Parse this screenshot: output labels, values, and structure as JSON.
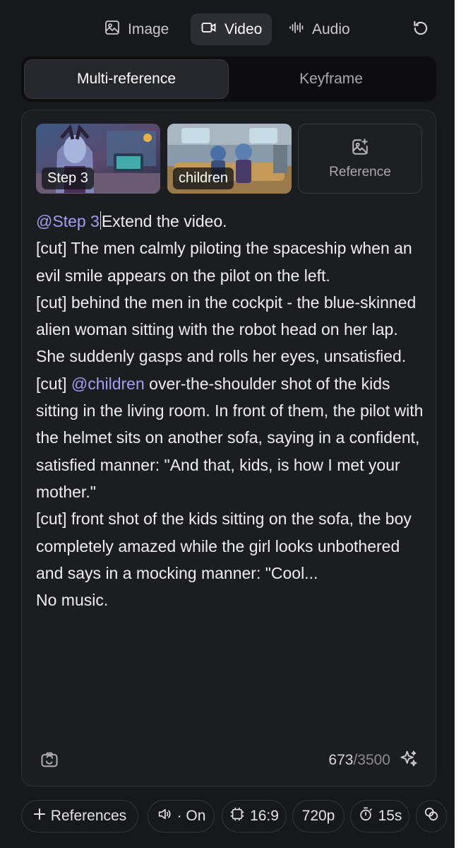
{
  "modes": {
    "image": "Image",
    "video": "Video",
    "audio": "Audio"
  },
  "tabs": {
    "multi_reference": "Multi-reference",
    "keyframe": "Keyframe"
  },
  "references": [
    {
      "label": "Step 3"
    },
    {
      "label": "children"
    }
  ],
  "add_reference_label": "Reference",
  "prompt": {
    "mention_step3": "@Step 3",
    "line1": "Extend the video.",
    "para2": "[cut] The men calmly piloting the spaceship when an evil smile appears on the pilot on the left.",
    "para3": "[cut] behind the men in the cockpit - the blue-skinned alien woman sitting with the robot head on her lap. She suddenly gasps and rolls her eyes, unsatisfied.",
    "para4_prefix": "[cut] ",
    "mention_children": "@children",
    "para4_rest": " over-the-shoulder shot of the kids sitting in the living room. In front of them, the pilot with the helmet sits on another sofa, saying in a confident, satisfied manner: \"And that, kids, is how I met your mother.\"",
    "para5": "[cut] front shot of the kids sitting on the sofa, the boy completely amazed while the girl looks unbothered and says in a mocking manner: \"Cool...",
    "para6": "No music."
  },
  "counter": {
    "current": "673",
    "max": "/3500"
  },
  "chips": {
    "references": "References",
    "sound": "· On",
    "aspect": "16:9",
    "resolution": "720p",
    "duration": "15s"
  },
  "colors": {
    "panel_bg": "#17181b",
    "mention": "#a79bf2",
    "active_tab": "#26272c"
  }
}
